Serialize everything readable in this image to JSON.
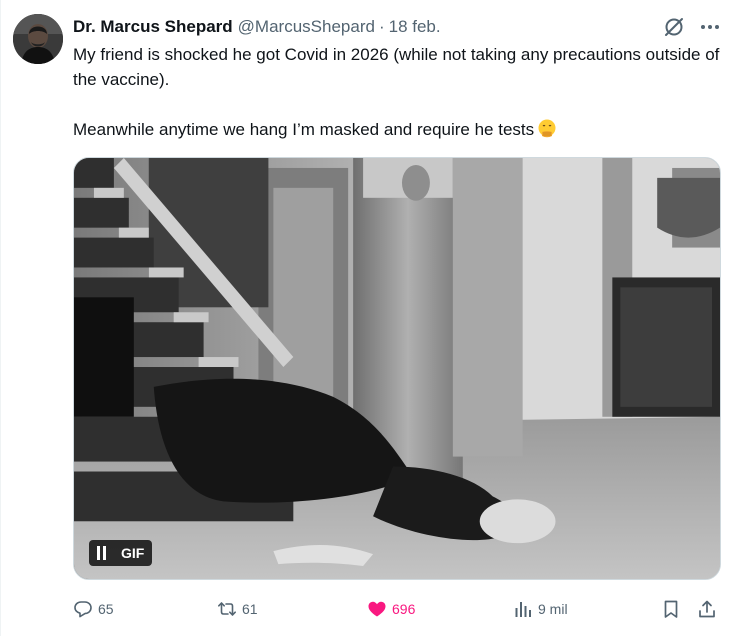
{
  "author": {
    "name": "Dr. Marcus Shepard",
    "handle": "@MarcusShepard",
    "separator": "·",
    "date": "18 feb."
  },
  "tweet": {
    "line1": "My friend is shocked he got Covid in 2026 (while not taking any precautions outside of the vaccine).",
    "line2": "Meanwhile anytime we hang I’m masked and require he tests",
    "emoji": "face-with-hand-over-mouth-emoji"
  },
  "media": {
    "badge": "GIF",
    "icon": "pause-icon"
  },
  "actions": {
    "replies": "65",
    "reposts": "61",
    "likes": "696",
    "views": "9 mil"
  },
  "colors": {
    "text": "#0f1419",
    "secondary": "#536471",
    "like": "#f91880",
    "border": "#cfd9de"
  }
}
